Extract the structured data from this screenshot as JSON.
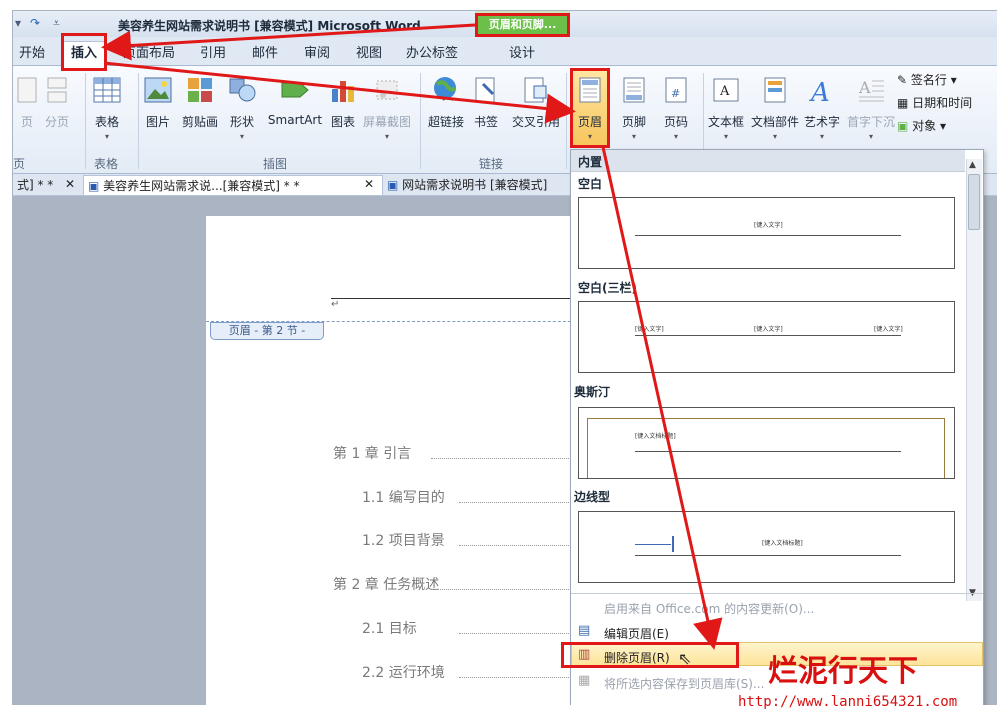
{
  "window": {
    "title": "美容养生网站需求说明书 [兼容模式] Microsoft Word",
    "context_tab_title": "页眉和页脚...",
    "context_tab": "设计"
  },
  "tabs": [
    "开始",
    "插入",
    "页面布局",
    "引用",
    "邮件",
    "审阅",
    "视图",
    "办公标签"
  ],
  "ribbon": {
    "pages_partial": [
      "页",
      "分页"
    ],
    "table": "表格",
    "illustrations": [
      "图片",
      "剪贴画",
      "形状",
      "SmartArt",
      "图表",
      "屏幕截图"
    ],
    "links": [
      "超链接",
      "书签",
      "交叉引用"
    ],
    "header_footer": [
      "页眉",
      "页脚",
      "页码"
    ],
    "text": [
      "文本框",
      "文档部件",
      "艺术字",
      "首字下沉"
    ],
    "text_small": [
      "签名行",
      "日期和时间",
      "对象"
    ],
    "groups": [
      "页",
      "表格",
      "插图",
      "链接"
    ]
  },
  "doc_tabs": [
    "式] * *",
    "美容养生网站需求说...[兼容模式] * *",
    "网站需求说明书 [兼容模式]"
  ],
  "document": {
    "header_label": "页眉 - 第 2 节 -",
    "para_mark": "↵",
    "toc": [
      {
        "text": "第 1 章  引言",
        "level": 1
      },
      {
        "text": "1.1 编写目的",
        "level": 2
      },
      {
        "text": "1.2 项目背景",
        "level": 2
      },
      {
        "text": "第 2 章  任务概述",
        "level": 1
      },
      {
        "text": "2.1 目标",
        "level": 2
      },
      {
        "text": "2.2 运行环境",
        "level": 2
      }
    ]
  },
  "dropdown": {
    "category": "内置",
    "items": [
      {
        "name": "空白",
        "placeholder": "[键入文字]"
      },
      {
        "name": "空白(三栏)",
        "placeholder": "[键入文字]"
      },
      {
        "name": "奥斯汀",
        "placeholder": "[键入文档标题]"
      },
      {
        "name": "边线型",
        "placeholder": "[键入文档标题]"
      }
    ],
    "menu": [
      "启用来自 Office.com 的内容更新(O)...",
      "编辑页眉(E)",
      "删除页眉(R)",
      "将所选内容保存到页眉库(S)..."
    ]
  },
  "watermark": {
    "brand": "烂泥行天下",
    "url": "http://www.lanni654321.com"
  },
  "colors": {
    "highlight_red": "#e01818",
    "context_green": "#6cc04a",
    "hover": "#fde49a"
  }
}
